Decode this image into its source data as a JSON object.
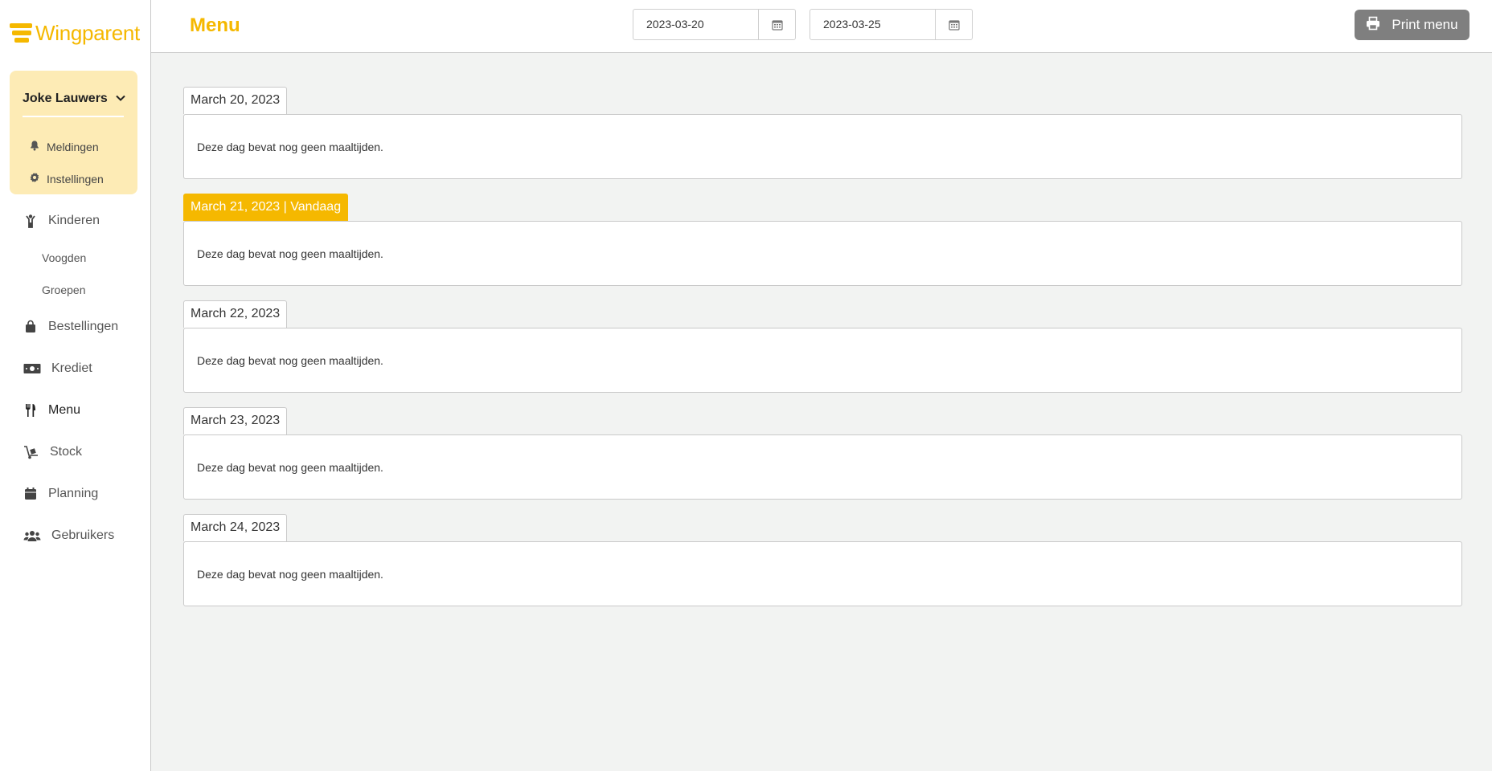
{
  "brand": {
    "name": "Wingparent",
    "color": "#f5b800"
  },
  "user": {
    "name": "Joke Lauwers",
    "items": [
      {
        "label": "Meldingen",
        "icon": "bell-icon"
      },
      {
        "label": "Instellingen",
        "icon": "gear-icon"
      }
    ]
  },
  "sidebar": {
    "items": [
      {
        "label": "Kinderen",
        "icon": "child-icon"
      },
      {
        "label": "Voogden"
      },
      {
        "label": "Groepen"
      },
      {
        "label": "Bestellingen",
        "icon": "shopping-bag-icon"
      },
      {
        "label": "Krediet",
        "icon": "money-icon"
      },
      {
        "label": "Menu",
        "icon": "utensils-icon",
        "active": true
      },
      {
        "label": "Stock",
        "icon": "dolly-icon"
      },
      {
        "label": "Planning",
        "icon": "calendar-icon"
      },
      {
        "label": "Gebruikers",
        "icon": "users-icon"
      }
    ]
  },
  "header": {
    "title": "Menu",
    "date_from": "2023-03-20",
    "date_to": "2023-03-25",
    "print_label": "Print menu"
  },
  "days": [
    {
      "label": "March 20, 2023",
      "today": false,
      "message": "Deze dag bevat nog geen maaltijden."
    },
    {
      "label": "March 21, 2023 | Vandaag",
      "today": true,
      "message": "Deze dag bevat nog geen maaltijden."
    },
    {
      "label": "March 22, 2023",
      "today": false,
      "message": "Deze dag bevat nog geen maaltijden."
    },
    {
      "label": "March 23, 2023",
      "today": false,
      "message": "Deze dag bevat nog geen maaltijden."
    },
    {
      "label": "March 24, 2023",
      "today": false,
      "message": "Deze dag bevat nog geen maaltijden."
    }
  ]
}
